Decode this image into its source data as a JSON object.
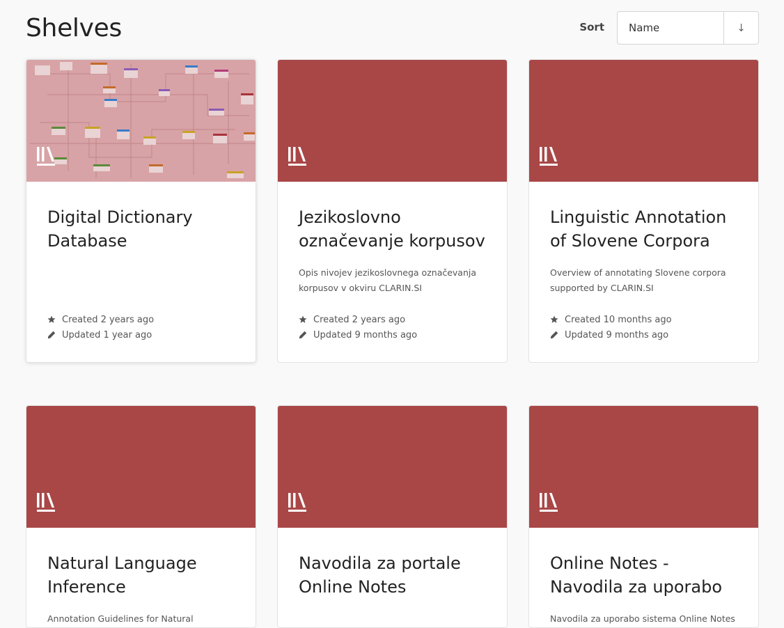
{
  "page": {
    "title": "Shelves"
  },
  "sort": {
    "label": "Sort",
    "selected": "Name",
    "direction_icon": "arrow-down-icon",
    "direction_glyph": "↓"
  },
  "colors": {
    "cover": "#a94747",
    "diagram_cover": "#d8a3a6"
  },
  "shelves": [
    {
      "title": "Digital Dictionary Database",
      "description": "",
      "created": "Created 2 years ago",
      "updated": "Updated 1 year ago",
      "cover": "diagram"
    },
    {
      "title": "Jezikoslovno označevanje korpusov",
      "description": "Opis nivojev jezikoslovnega označevanja korpusov v okviru CLARIN.SI",
      "created": "Created 2 years ago",
      "updated": "Updated 9 months ago",
      "cover": "default"
    },
    {
      "title": "Linguistic Annotation of Slovene Corpora",
      "description": "Overview of annotating Slovene corpora supported by CLARIN.SI",
      "created": "Created 10 months ago",
      "updated": "Updated 9 months ago",
      "cover": "default"
    },
    {
      "title": "Natural Language Inference",
      "description": "Annotation Guidelines for Natural",
      "cover": "default"
    },
    {
      "title": "Navodila za portale Online Notes",
      "description": "",
      "cover": "default"
    },
    {
      "title": "Online Notes - Navodila za uporabo",
      "description": "Navodila za uporabo sistema Online Notes",
      "cover": "default"
    }
  ]
}
